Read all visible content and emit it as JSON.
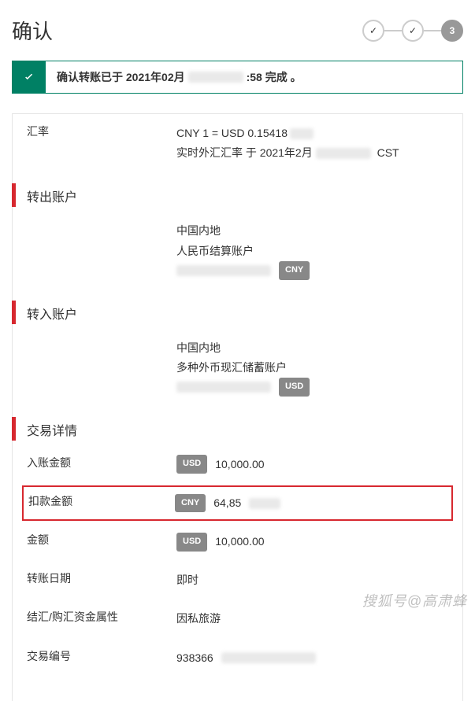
{
  "header": {
    "title": "确认",
    "steps": {
      "current": "3"
    }
  },
  "alert": {
    "prefix": "确认转账已于 2021年02月",
    "suffix": ":58 完成 。"
  },
  "sections": {
    "from": "转出账户",
    "to": "转入账户",
    "txn": "交易详情"
  },
  "from": {
    "region": "中国内地",
    "account_type": "人民币结算账户",
    "currency": "CNY"
  },
  "to": {
    "region": "中国内地",
    "account_type": "多种外币现汇储蓄账户",
    "currency": "USD"
  },
  "rows": {
    "rate": {
      "label": "汇率",
      "line1_prefix": "CNY 1 = USD 0.15418",
      "line2_prefix": "实时外汇汇率 于 2021年2月",
      "line2_suffix": " CST"
    },
    "credit": {
      "label": "入账金额",
      "currency": "USD",
      "amount": "10,000.00"
    },
    "debit": {
      "label": "扣款金额",
      "currency": "CNY",
      "amount_prefix": "64,85"
    },
    "amount": {
      "label": "金额",
      "currency": "USD",
      "amount": "10,000.00"
    },
    "date": {
      "label": "转账日期",
      "value": "即时"
    },
    "purpose": {
      "label": "结汇/购汇资金属性",
      "value": "因私旅游"
    },
    "txn_no": {
      "label": "交易编号",
      "prefix": "938366"
    }
  },
  "watermark": "搜狐号@高肃蜂"
}
